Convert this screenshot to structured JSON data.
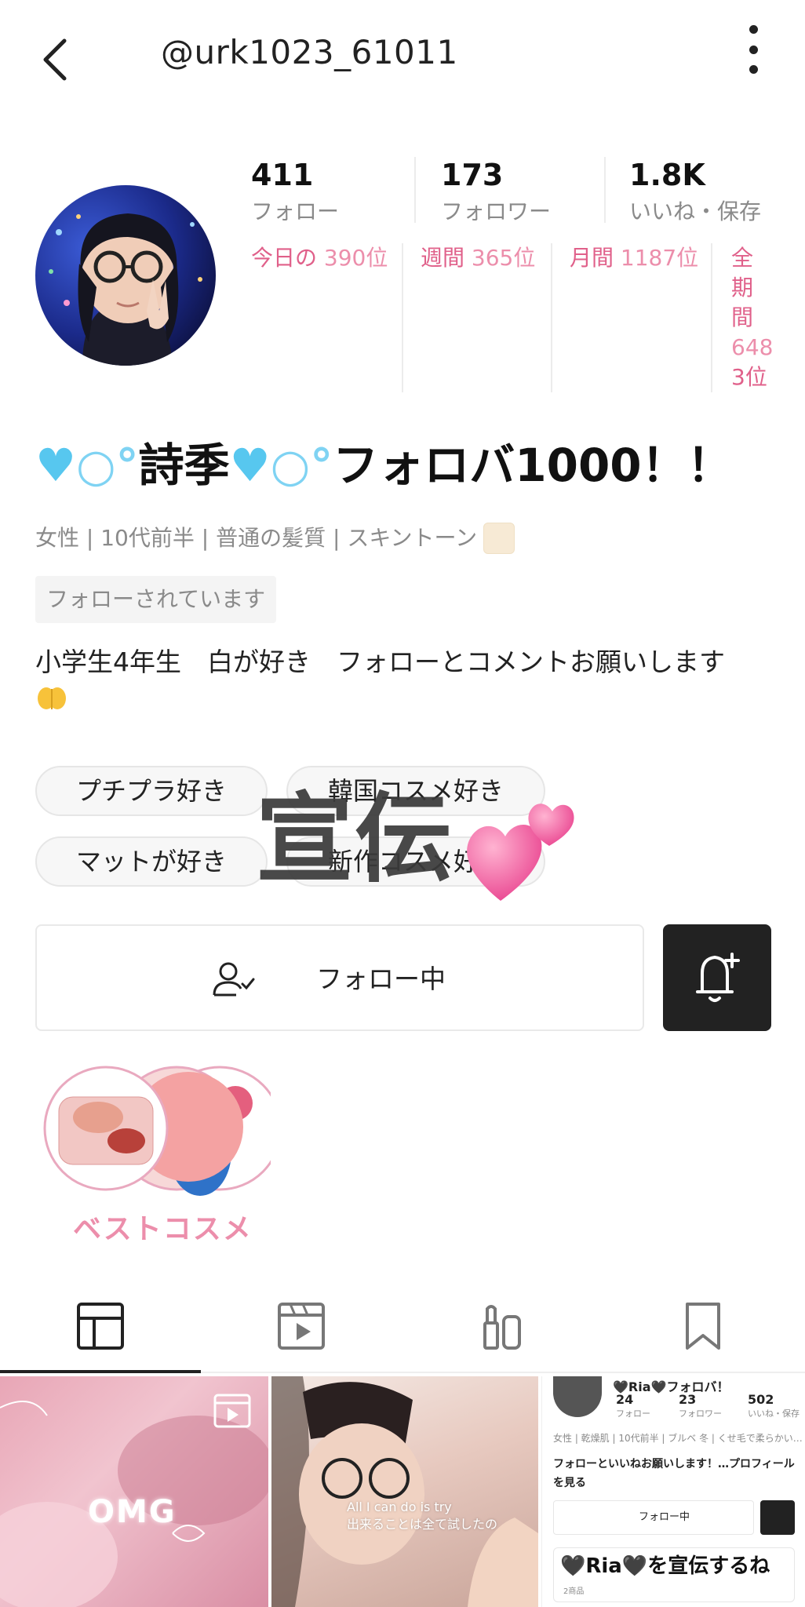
{
  "header": {
    "username": "@urk1023_61011"
  },
  "stats": [
    {
      "value": "411",
      "label": "フォロー"
    },
    {
      "value": "173",
      "label": "フォロワー"
    },
    {
      "value": "1.8K",
      "label": "いいね・保存"
    }
  ],
  "ranks": {
    "today_label": "今日の",
    "today_value": "390位",
    "weekly_label": "週間",
    "weekly_value": "365位",
    "monthly_label": "月間",
    "monthly_value": "1187位",
    "alltime_label_lines": [
      "全",
      "期",
      "間"
    ],
    "alltime_value_lines": [
      "648",
      "3位"
    ]
  },
  "profile": {
    "display_name_text_1": "詩季",
    "display_name_text_2": "フォロバ1000！！",
    "attributes": "女性 | 10代前半 | 普通の髪質 | スキントーン",
    "follows_you": "フォローされています",
    "bio": "小学生4年生　白が好き　フォローとコメントお願いします"
  },
  "tags": [
    "プチプラ好き",
    "韓国コスメ好き",
    "マットが好き",
    "新作コスメ好き"
  ],
  "overlay": {
    "text": "宣伝"
  },
  "actions": {
    "follow_label": "フォロー中"
  },
  "best_cosme": {
    "label": "ベストコスメ"
  },
  "tabs": [
    "posts-grid-icon",
    "video-icon",
    "cosme-icon",
    "bookmark-icon"
  ],
  "grid": {
    "cell1_text": "OMG",
    "cell2_text_line1": "All I can do is try",
    "cell2_text_line2": "出来ることは全て試したの",
    "cell3": {
      "name": "🖤Ria🖤フォロバ！",
      "stats": [
        {
          "value": "24",
          "label": "フォロー"
        },
        {
          "value": "23",
          "label": "フォロワー"
        },
        {
          "value": "502",
          "label": "いいね・保存"
        }
      ],
      "attributes": "女性 | 乾燥肌 | 10代前半 | ブルベ 冬 | くせ毛で柔らかい…",
      "bio": "フォローといいねお願いします！…プロフィールを見る",
      "follow_label": "フォロー中",
      "card_title": "🖤Ria🖤を宣伝するね",
      "card_sub": "2商品"
    }
  },
  "colors": {
    "rank_pink": "#e0608a",
    "accent_pink": "#ec8eab",
    "dark": "#222222"
  }
}
